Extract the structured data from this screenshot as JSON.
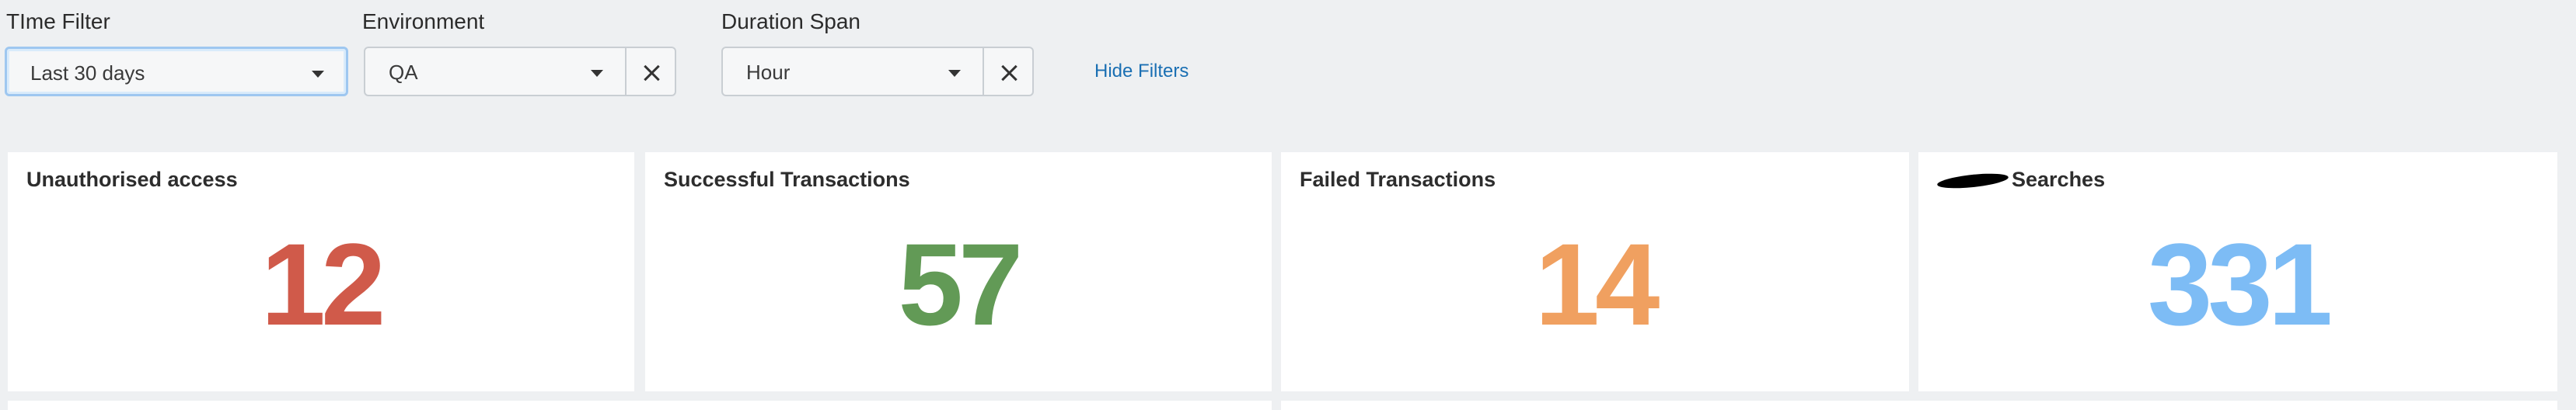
{
  "filters": {
    "time": {
      "label": "TIme Filter",
      "value": "Last 30 days"
    },
    "environment": {
      "label": "Environment",
      "value": "QA"
    },
    "duration": {
      "label": "Duration Span",
      "value": "Hour"
    },
    "hide_link": "Hide Filters"
  },
  "panels": [
    {
      "title": "Unauthorised access",
      "value": "12",
      "color": "#d05a4a"
    },
    {
      "title": "Successful Transactions",
      "value": "57",
      "color": "#629a56"
    },
    {
      "title": "Failed Transactions",
      "value": "14",
      "color": "#f0a060"
    },
    {
      "title": "Searches",
      "value": "331",
      "color": "#7dbcf5"
    }
  ],
  "icons": {
    "dropdown": "chevron-down-icon",
    "clear": "close-icon"
  }
}
